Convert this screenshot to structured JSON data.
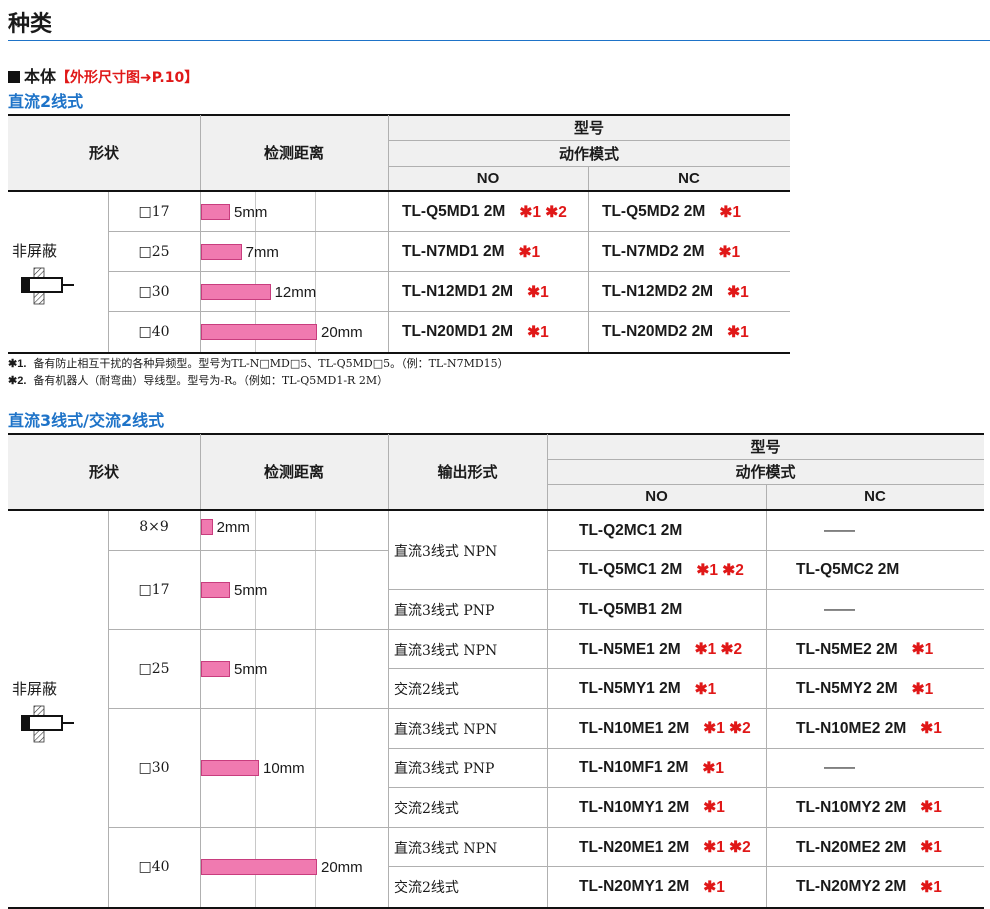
{
  "page": {
    "title": "种类",
    "section_label": "本体",
    "section_ref": "【外形尺寸图➜P.10】"
  },
  "table1": {
    "heading": "直流2线式",
    "col_shape": "形状",
    "col_distance": "检测距离",
    "col_model": "型号",
    "col_mode": "动作模式",
    "col_no": "NO",
    "col_nc": "NC",
    "shield": "非屏蔽",
    "rows": [
      {
        "size": "□17",
        "distance": "5mm",
        "distance_mm": 5,
        "no": "TL-Q5MD1 2M",
        "no_notes": "✱1 ✱2",
        "nc": "TL-Q5MD2 2M",
        "nc_notes": "✱1"
      },
      {
        "size": "□25",
        "distance": "7mm",
        "distance_mm": 7,
        "no": "TL-N7MD1 2M",
        "no_notes": "✱1",
        "nc": "TL-N7MD2 2M",
        "nc_notes": "✱1"
      },
      {
        "size": "□30",
        "distance": "12mm",
        "distance_mm": 12,
        "no": "TL-N12MD1 2M",
        "no_notes": "✱1",
        "nc": "TL-N12MD2 2M",
        "nc_notes": "✱1"
      },
      {
        "size": "□40",
        "distance": "20mm",
        "distance_mm": 20,
        "no": "TL-N20MD1 2M",
        "no_notes": "✱1",
        "nc": "TL-N20MD2 2M",
        "nc_notes": "✱1"
      }
    ],
    "notes": [
      {
        "mark": "✱1.",
        "text": "备有防止相互干扰的各种异频型。型号为TL-N□MD□5、TL-Q5MD□5。（例：TL-N7MD15）"
      },
      {
        "mark": "✱2.",
        "text": "备有机器人（耐弯曲）导线型。型号为-R。（例如：TL-Q5MD1-R 2M）"
      }
    ]
  },
  "table2": {
    "heading": "直流3线式/交流2线式",
    "col_shape": "形状",
    "col_distance": "检测距离",
    "col_output": "输出形式",
    "col_model": "型号",
    "col_mode": "动作模式",
    "col_no": "NO",
    "col_nc": "NC",
    "shield": "非屏蔽",
    "groups": [
      {
        "size": "8×9",
        "distance": "2mm",
        "distance_mm": 2
      },
      {
        "size": "□17",
        "distance": "5mm",
        "distance_mm": 5
      },
      {
        "size": "□25",
        "distance": "5mm",
        "distance_mm": 5
      },
      {
        "size": "□30",
        "distance": "10mm",
        "distance_mm": 10
      },
      {
        "size": "□40",
        "distance": "20mm",
        "distance_mm": 20
      }
    ],
    "outputs": [
      "直流3线式 NPN",
      "直流3线式 PNP",
      "直流3线式 NPN",
      "交流2线式",
      "直流3线式 NPN",
      "直流3线式 PNP",
      "交流2线式",
      "直流3线式 NPN",
      "交流2线式"
    ],
    "rows": [
      {
        "no": "TL-Q2MC1 2M",
        "no_notes": "",
        "nc": "——",
        "nc_notes": ""
      },
      {
        "no": "TL-Q5MC1 2M",
        "no_notes": "✱1 ✱2",
        "nc": "TL-Q5MC2 2M",
        "nc_notes": ""
      },
      {
        "no": "TL-Q5MB1 2M",
        "no_notes": "",
        "nc": "——",
        "nc_notes": ""
      },
      {
        "no": "TL-N5ME1 2M",
        "no_notes": "✱1 ✱2",
        "nc": "TL-N5ME2 2M",
        "nc_notes": "✱1"
      },
      {
        "no": "TL-N5MY1 2M",
        "no_notes": "✱1",
        "nc": "TL-N5MY2 2M",
        "nc_notes": "✱1"
      },
      {
        "no": "TL-N10ME1 2M",
        "no_notes": "✱1 ✱2",
        "nc": "TL-N10ME2 2M",
        "nc_notes": "✱1"
      },
      {
        "no": "TL-N10MF1 2M",
        "no_notes": "✱1",
        "nc": "——",
        "nc_notes": ""
      },
      {
        "no": "TL-N10MY1 2M",
        "no_notes": "✱1",
        "nc": "TL-N10MY2 2M",
        "nc_notes": "✱1"
      },
      {
        "no": "TL-N20ME1 2M",
        "no_notes": "✱1 ✱2",
        "nc": "TL-N20ME2 2M",
        "nc_notes": "✱1"
      },
      {
        "no": "TL-N20MY1 2M",
        "no_notes": "✱1",
        "nc": "TL-N20MY2 2M",
        "nc_notes": "✱1"
      }
    ]
  },
  "colors": {
    "accent_blue": "#1e73c8",
    "note_red": "#e01818",
    "bar_pink": "#f07ab0",
    "header_gray": "#f0f0f0"
  }
}
